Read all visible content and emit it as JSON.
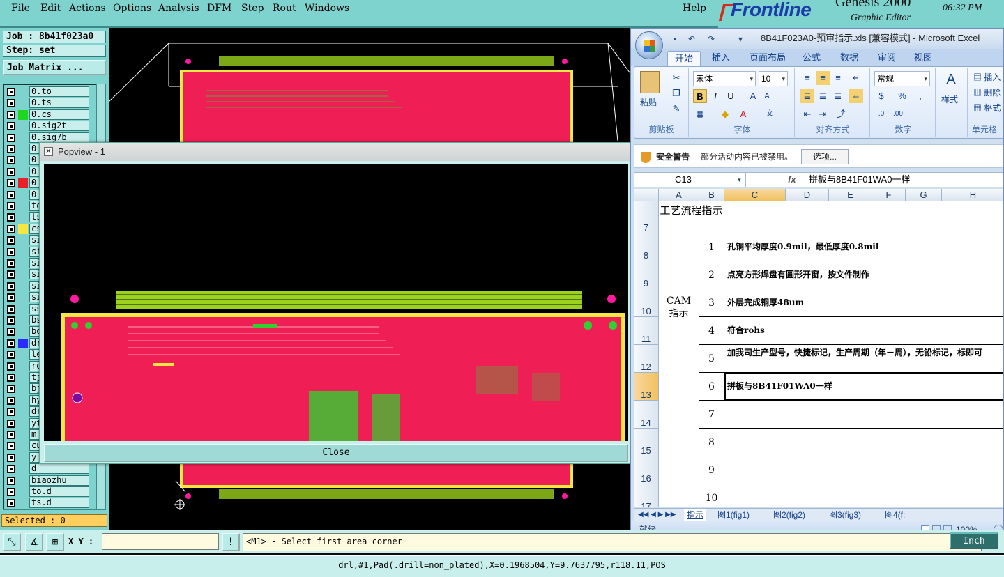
{
  "genesis": {
    "menu": [
      "File",
      "Edit",
      "Actions",
      "Options",
      "Analysis",
      "DFM",
      "Step",
      "Rout",
      "Windows"
    ],
    "help": "Help",
    "brand": "Frontline",
    "app_title": "Genesis 2000",
    "app_subtitle": "Graphic Editor",
    "clock": "06:32 PM",
    "job": "Job : 8b41f023a0",
    "step": "Step: set",
    "job_matrix": "Job Matrix ...",
    "layers": [
      {
        "name": "0.to",
        "swatch": ""
      },
      {
        "name": "0.ts",
        "swatch": ""
      },
      {
        "name": "0.cs",
        "swatch": "#1fd51f"
      },
      {
        "name": "0.sig2t",
        "swatch": ""
      },
      {
        "name": "0.sig7b",
        "swatch": ""
      },
      {
        "name": "0",
        "swatch": ""
      },
      {
        "name": "0",
        "swatch": ""
      },
      {
        "name": "0",
        "swatch": ""
      },
      {
        "name": "0",
        "swatch": "#e8202a"
      },
      {
        "name": "0",
        "swatch": ""
      },
      {
        "name": "to",
        "swatch": ""
      },
      {
        "name": "ts",
        "swatch": ""
      },
      {
        "name": "cs",
        "swatch": "#f5e642"
      },
      {
        "name": "si",
        "swatch": ""
      },
      {
        "name": "si",
        "swatch": ""
      },
      {
        "name": "si",
        "swatch": ""
      },
      {
        "name": "si",
        "swatch": ""
      },
      {
        "name": "si",
        "swatch": ""
      },
      {
        "name": "si",
        "swatch": ""
      },
      {
        "name": "ss",
        "swatch": ""
      },
      {
        "name": "bs",
        "swatch": ""
      },
      {
        "name": "bo",
        "swatch": ""
      },
      {
        "name": "dr",
        "swatch": "#2b2bff"
      },
      {
        "name": "le",
        "swatch": ""
      },
      {
        "name": "ro",
        "swatch": ""
      },
      {
        "name": "tj",
        "swatch": ""
      },
      {
        "name": "bj",
        "swatch": ""
      },
      {
        "name": "hy",
        "swatch": ""
      },
      {
        "name": "dr",
        "swatch": ""
      },
      {
        "name": "yt",
        "swatch": ""
      },
      {
        "name": "m",
        "swatch": ""
      },
      {
        "name": "cu",
        "swatch": ""
      },
      {
        "name": "y",
        "swatch": ""
      },
      {
        "name": "d",
        "swatch": ""
      },
      {
        "name": "biaozhu",
        "swatch": ""
      },
      {
        "name": "to.d",
        "swatch": ""
      },
      {
        "name": "ts.d",
        "swatch": ""
      }
    ],
    "selected": "Selected : 0",
    "xy_label": "X Y :",
    "prompt": "<M1> - Select first area corner",
    "status": "drl,#1,Pad(.drill=non_plated),X=0.1968504,Y=9.7637795,r118.11,POS",
    "units": "Inch",
    "popview_title": "Popview - 1",
    "popview_close": "Close",
    "colors": {
      "board": "#ef1f55",
      "outline": "#f5e642",
      "trace": "#2fd02f",
      "pad": "#ff1aa0"
    }
  },
  "excel": {
    "title": "8B41F023A0-预审指示.xls  [兼容模式] - Microsoft Excel",
    "tabs": [
      "开始",
      "插入",
      "页面布局",
      "公式",
      "数据",
      "审阅",
      "视图"
    ],
    "active_tab": "开始",
    "clipboard": {
      "paste": "粘贴",
      "label": "剪贴板"
    },
    "font": {
      "name": "宋体",
      "size": "10",
      "label": "字体",
      "bold": "B",
      "italic": "I",
      "underline": "U"
    },
    "align_label": "对齐方式",
    "number": {
      "format": "常规",
      "label": "数字",
      "percent": "%"
    },
    "styles_label": "样式",
    "cells_group": {
      "insert": "插入",
      "delete": "删除",
      "format": "格式",
      "label": "单元格"
    },
    "security": {
      "label": "安全警告",
      "message": "部分活动内容已被禁用。",
      "options": "选项..."
    },
    "namebox": "C13",
    "fx": "fx",
    "formula": "拼板与8B41F01WA0一样",
    "columns": [
      "A",
      "B",
      "C",
      "D",
      "E",
      "F",
      "G",
      "H"
    ],
    "rows": [
      {
        "num": "7",
        "a": "工艺流程指示",
        "b": "",
        "c": ""
      },
      {
        "num": "8",
        "a": "",
        "b": "1",
        "c": "孔铜平均厚度0.9mil，最低厚度0.8mil"
      },
      {
        "num": "9",
        "a": "",
        "b": "2",
        "c": "点亮方形焊盘有圆形开窗，按文件制作"
      },
      {
        "num": "10",
        "a": "CAM指示",
        "b": "3",
        "c": "外层完成铜厚48um"
      },
      {
        "num": "11",
        "a": "",
        "b": "4",
        "c": "符合rohs"
      },
      {
        "num": "12",
        "a": "",
        "b": "5",
        "c": "加我司生产型号，快捷标记，生产周期（年－周），无铅标记，标即可"
      },
      {
        "num": "13",
        "a": "",
        "b": "6",
        "c": "拼板与8B41F01WA0一样"
      },
      {
        "num": "14",
        "a": "",
        "b": "7",
        "c": ""
      },
      {
        "num": "15",
        "a": "",
        "b": "8",
        "c": ""
      },
      {
        "num": "16",
        "a": "",
        "b": "9",
        "c": ""
      },
      {
        "num": "17",
        "a": "",
        "b": "10",
        "c": ""
      }
    ],
    "sheets": [
      "指示",
      "图1(fig1)",
      "图2(fig2)",
      "图3(fig3)",
      "图4(f:"
    ],
    "status": "就绪",
    "zoom": "100%"
  }
}
